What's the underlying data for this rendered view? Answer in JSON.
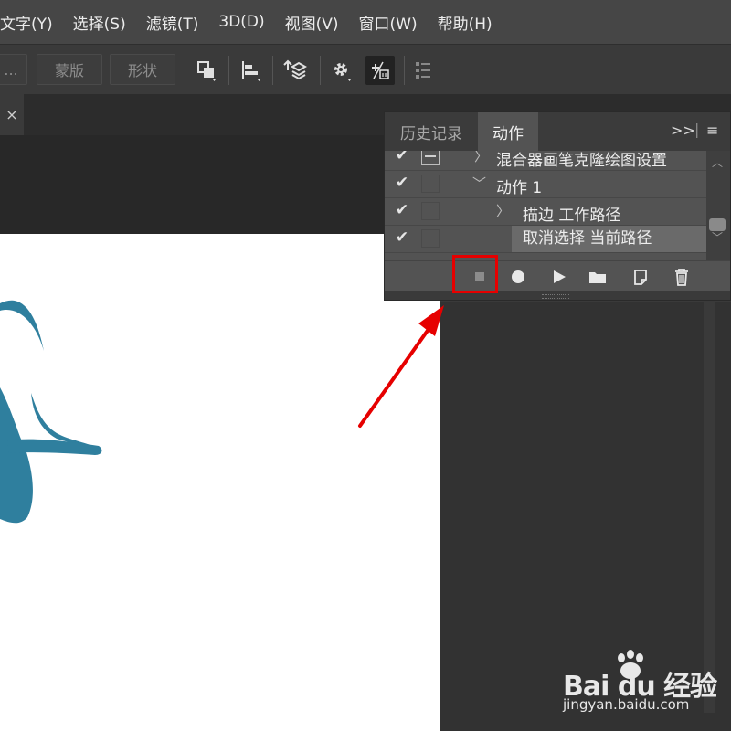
{
  "menubar": {
    "items": [
      "文字(Y)",
      "选择(S)",
      "滤镜(T)",
      "3D(D)",
      "视图(V)",
      "窗口(W)",
      "帮助(H)"
    ]
  },
  "options_bar": {
    "truncated_button": "...",
    "mask_button": "蒙版",
    "shape_button": "形状"
  },
  "document_tab": {
    "close_glyph": "×"
  },
  "actions_panel": {
    "tabs": [
      "历史记录",
      "动作"
    ],
    "active_tab": "动作",
    "expand_glyph": ">>",
    "menu_glyph": "≡",
    "rows": [
      {
        "checked": true,
        "dialog": true,
        "expander": "〉",
        "label": "混合器画笔克隆绘图设置",
        "indent": 0
      },
      {
        "checked": true,
        "dialog": false,
        "expander": "﹀",
        "label": "动作 1",
        "indent": 0
      },
      {
        "checked": true,
        "dialog": false,
        "expander": "〉",
        "label": "描边 工作路径",
        "indent": 1
      },
      {
        "checked": true,
        "dialog": false,
        "expander": "",
        "label": "取消选择 当前路径",
        "indent": 1,
        "selected": true
      }
    ],
    "footer_buttons": [
      "stop-recording",
      "begin-recording",
      "play-selection",
      "create-new-set",
      "create-new-action",
      "delete"
    ],
    "highlighted_button": "stop-recording"
  },
  "colors": {
    "menubar_bg": "#464646",
    "panel_bg": "#535353",
    "highlight": "#e60000",
    "artwork": "#2f7f9e"
  },
  "watermark": {
    "logo_text": "Bai du 经验",
    "url": "jingyan.baidu.com"
  }
}
